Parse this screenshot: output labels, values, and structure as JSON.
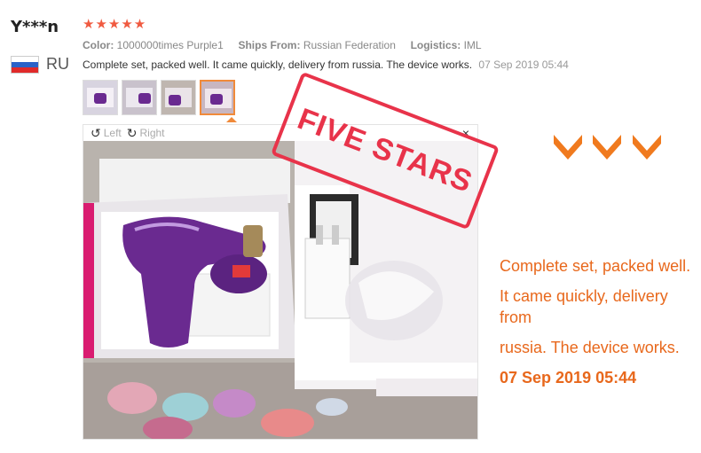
{
  "reviewer": {
    "name": "Y***n",
    "country_code": "RU",
    "flag_icon": "russia-flag-icon"
  },
  "review": {
    "rating_stars": "★★★★★",
    "rating": 5,
    "color_label": "Color:",
    "color_value": "1000000times Purple1",
    "ships_label": "Ships From:",
    "ships_value": "Russian Federation",
    "logistics_label": "Logistics:",
    "logistics_value": "IML",
    "text": "Complete set, packed well. It came quickly, delivery from russia. The device works.",
    "date": "07 Sep 2019 05:44"
  },
  "viewer": {
    "rotate_left": "Left",
    "rotate_right": "Right",
    "close": "×",
    "stamp": "FIVE STARS"
  },
  "callout": {
    "line1": "Complete set, packed well.",
    "line2": "It came quickly, delivery from",
    "line3": "russia. The device works.",
    "date": "07 Sep 2019 05:44"
  },
  "colors": {
    "star": "#f05a40",
    "accent_orange": "#e8681c",
    "stamp_red": "#e8334a",
    "device_purple": "#6a2a90"
  }
}
